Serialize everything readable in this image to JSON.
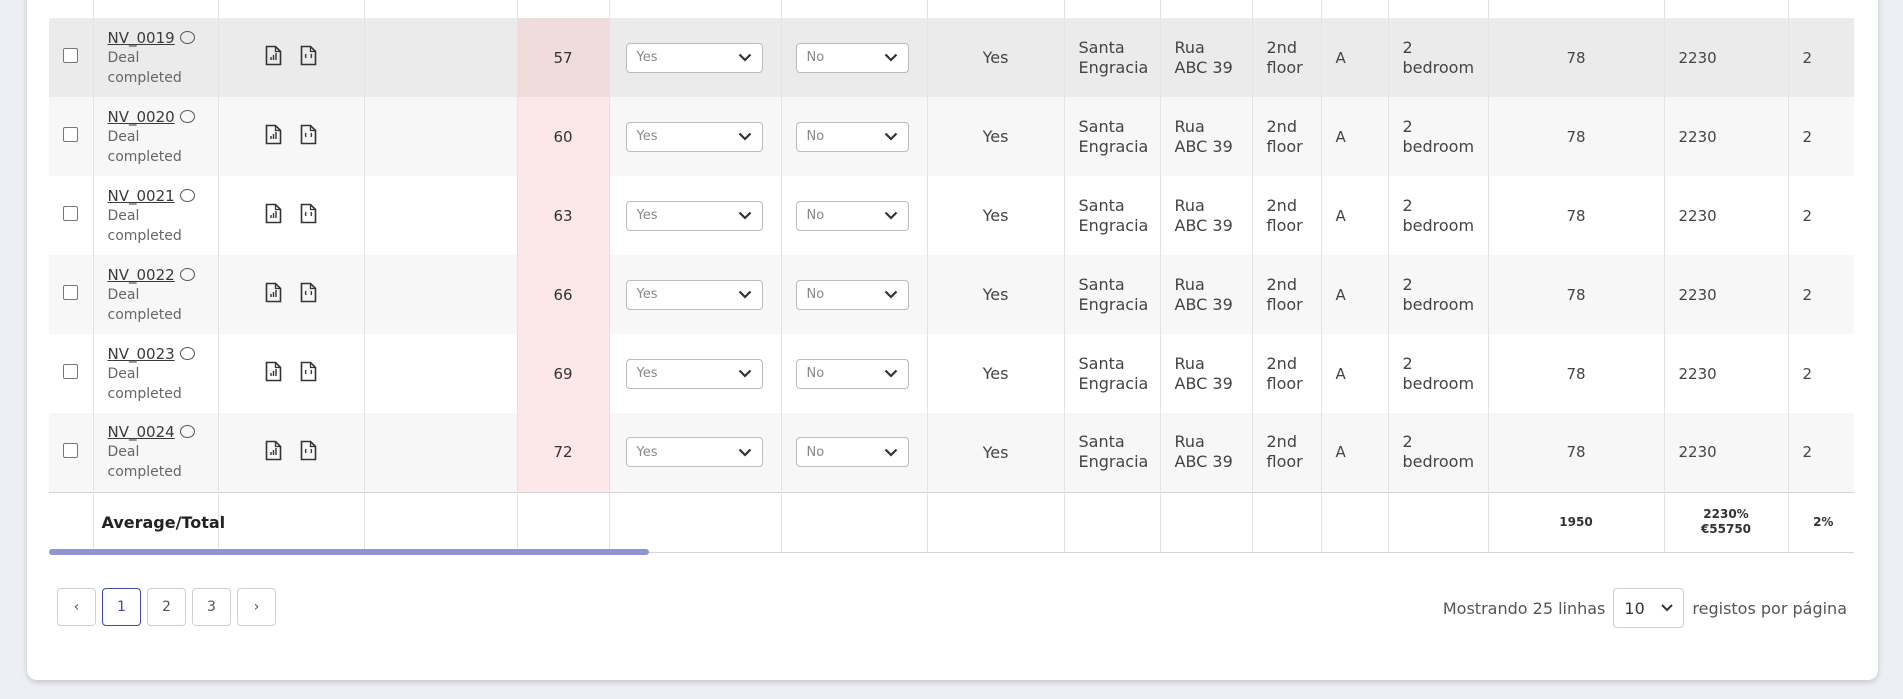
{
  "rows": [
    {
      "id": "NV_0019",
      "status_line1": "Deal",
      "status_line2": "completed",
      "ohm": "57",
      "sel1": "Yes",
      "sel2": "No",
      "flag": "Yes",
      "area_l1": "Santa",
      "area_l2": "Engracia",
      "street_l1": "Rua",
      "street_l2": "ABC 39",
      "floor_l1": "2nd",
      "floor_l2": "floor",
      "cls": "A",
      "type_l1": "2",
      "type_l2": "bedroom",
      "m2": "78",
      "price": "2230",
      "rooms": "2"
    },
    {
      "id": "NV_0020",
      "status_line1": "Deal",
      "status_line2": "completed",
      "ohm": "60",
      "sel1": "Yes",
      "sel2": "No",
      "flag": "Yes",
      "area_l1": "Santa",
      "area_l2": "Engracia",
      "street_l1": "Rua",
      "street_l2": "ABC 39",
      "floor_l1": "2nd",
      "floor_l2": "floor",
      "cls": "A",
      "type_l1": "2",
      "type_l2": "bedroom",
      "m2": "78",
      "price": "2230",
      "rooms": "2"
    },
    {
      "id": "NV_0021",
      "status_line1": "Deal",
      "status_line2": "completed",
      "ohm": "63",
      "sel1": "Yes",
      "sel2": "No",
      "flag": "Yes",
      "area_l1": "Santa",
      "area_l2": "Engracia",
      "street_l1": "Rua",
      "street_l2": "ABC 39",
      "floor_l1": "2nd",
      "floor_l2": "floor",
      "cls": "A",
      "type_l1": "2",
      "type_l2": "bedroom",
      "m2": "78",
      "price": "2230",
      "rooms": "2"
    },
    {
      "id": "NV_0022",
      "status_line1": "Deal",
      "status_line2": "completed",
      "ohm": "66",
      "sel1": "Yes",
      "sel2": "No",
      "flag": "Yes",
      "area_l1": "Santa",
      "area_l2": "Engracia",
      "street_l1": "Rua",
      "street_l2": "ABC 39",
      "floor_l1": "2nd",
      "floor_l2": "floor",
      "cls": "A",
      "type_l1": "2",
      "type_l2": "bedroom",
      "m2": "78",
      "price": "2230",
      "rooms": "2"
    },
    {
      "id": "NV_0023",
      "status_line1": "Deal",
      "status_line2": "completed",
      "ohm": "69",
      "sel1": "Yes",
      "sel2": "No",
      "flag": "Yes",
      "area_l1": "Santa",
      "area_l2": "Engracia",
      "street_l1": "Rua",
      "street_l2": "ABC 39",
      "floor_l1": "2nd",
      "floor_l2": "floor",
      "cls": "A",
      "type_l1": "2",
      "type_l2": "bedroom",
      "m2": "78",
      "price": "2230",
      "rooms": "2"
    },
    {
      "id": "NV_0024",
      "status_line1": "Deal",
      "status_line2": "completed",
      "ohm": "72",
      "sel1": "Yes",
      "sel2": "No",
      "flag": "Yes",
      "area_l1": "Santa",
      "area_l2": "Engracia",
      "street_l1": "Rua",
      "street_l2": "ABC 39",
      "floor_l1": "2nd",
      "floor_l2": "floor",
      "cls": "A",
      "type_l1": "2",
      "type_l2": "bedroom",
      "m2": "78",
      "price": "2230",
      "rooms": "2"
    }
  ],
  "partial_row_text": "completed",
  "highlighted_row_id": "NV_0019",
  "totals": {
    "label": "Average/Total",
    "m2_total": "1950",
    "price_pct": "2230%",
    "price_total": "€55750",
    "rooms_pct": "2%"
  },
  "pagination": {
    "prev": "‹",
    "pages": [
      "1",
      "2",
      "3"
    ],
    "active_page": "1",
    "next": "›"
  },
  "footer": {
    "showing": "Mostrando 25 linhas",
    "per_page": "10",
    "per_page_label": "registos por página"
  },
  "colors": {
    "accent": "#3d4aa8",
    "scrollbar": "#8f94d3",
    "ohm_bg": "#fce8e8"
  },
  "icons": {
    "chat": "comment-icon",
    "report": "report-doc-icon",
    "spreadsheet": "sheet-doc-icon",
    "checkbox": "row-checkbox",
    "chevron": "chevron-down-icon"
  }
}
